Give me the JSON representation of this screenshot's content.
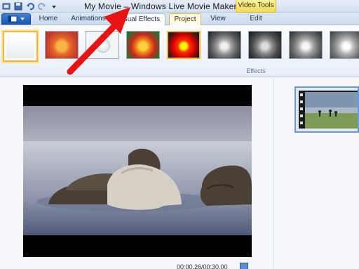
{
  "window": {
    "title": "My Movie – Windows Live Movie Maker",
    "context_tab": "Video Tools"
  },
  "quick_access": [
    "app-icon",
    "save-icon",
    "undo-icon",
    "redo-icon",
    "customize-dropdown-icon"
  ],
  "tabs": [
    {
      "label": "Home"
    },
    {
      "label": "Animations"
    },
    {
      "label": "Visual Effects"
    },
    {
      "label": "Project"
    },
    {
      "label": "View"
    },
    {
      "label": "Edit"
    }
  ],
  "ribbon": {
    "group_label": "Effects",
    "effects": [
      {
        "name": "no-effect",
        "state": "selected"
      },
      {
        "name": "sepia-blur"
      },
      {
        "name": "pixelate"
      },
      {
        "name": "color-original"
      },
      {
        "name": "high-contrast",
        "state": "hover"
      },
      {
        "name": "grayscale"
      },
      {
        "name": "grayscale-dark"
      },
      {
        "name": "grayscale-soft"
      },
      {
        "name": "grayscale-light"
      }
    ]
  },
  "preview": {
    "timecode": "00:00.26/00:30.00"
  },
  "colors": {
    "accent": "#f2b640",
    "arrow": "#e81313",
    "ribbon_tab_text": "#1b2f4f"
  }
}
